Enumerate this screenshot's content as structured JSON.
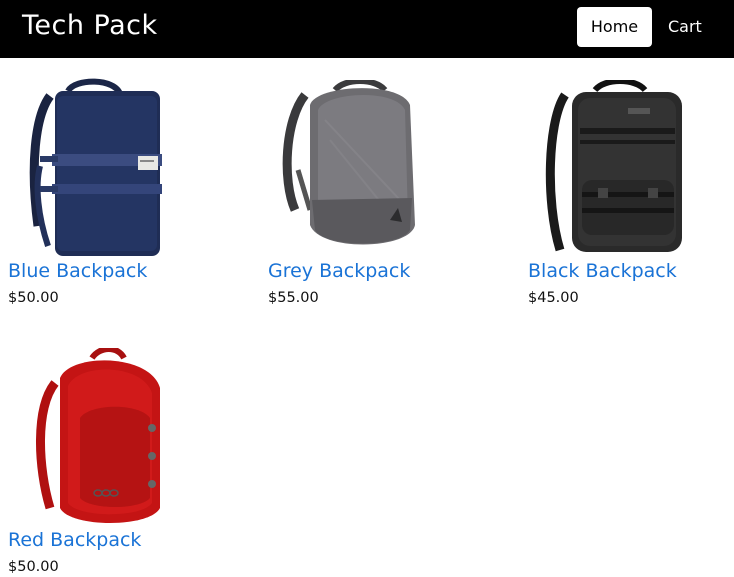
{
  "navbar": {
    "brand": "Tech Pack",
    "links": [
      {
        "label": "Home",
        "active": true
      },
      {
        "label": "Cart",
        "active": false
      }
    ]
  },
  "products": [
    {
      "name": "Blue Backpack",
      "price": "$50.00",
      "image": "blue-backpack-image"
    },
    {
      "name": "Grey Backpack",
      "price": "$55.00",
      "image": "grey-backpack-image"
    },
    {
      "name": "Black Backpack",
      "price": "$45.00",
      "image": "black-backpack-image"
    },
    {
      "name": "Red Backpack",
      "price": "$50.00",
      "image": "red-backpack-image"
    }
  ],
  "colors": {
    "navbar_bg": "#000000",
    "link": "#1a73d6",
    "text": "#111111"
  }
}
